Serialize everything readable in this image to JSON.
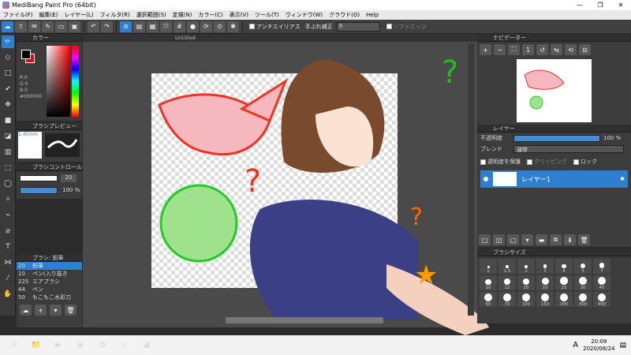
{
  "app": {
    "title": "MediBang Paint Pro (64bit)"
  },
  "menu": [
    "ファイル(F)",
    "編集(E)",
    "レイヤー(L)",
    "フィルタ(R)",
    "選択範囲(S)",
    "定規(N)",
    "カラー(C)",
    "表示(V)",
    "ツール(T)",
    "ウィンドウ(W)",
    "クラウド(O)",
    "Help"
  ],
  "toolbar": {
    "antialias_label": "アンチエイリアス",
    "stabilizer_label": "手ぶれ補正",
    "stabilizer_value": "8",
    "soft_edge_label": "ソフトエッジ"
  },
  "panels": {
    "color": {
      "title": "カラー",
      "r": "R:0",
      "g": "G:0",
      "b": "B:0",
      "hex": "#000000"
    },
    "brush_preview": {
      "title": "ブラシプレビュー",
      "size": "1.45mm"
    },
    "brush_control": {
      "title": "ブラシコントロール",
      "size_value": "20",
      "opacity_value": "100 %"
    },
    "brush_list": {
      "title": "ブラシ: 鉛筆",
      "items": [
        {
          "size": "20",
          "name": "鉛筆",
          "selected": true
        },
        {
          "size": "10",
          "name": "ペン(入り抜き",
          "selected": false
        },
        {
          "size": "225",
          "name": "エアブラシ",
          "selected": false
        },
        {
          "size": "44",
          "name": "ペン",
          "selected": false
        },
        {
          "size": "50",
          "name": "もこもこ水彩刀",
          "selected": false
        }
      ]
    },
    "navigator": {
      "title": "ナビゲーター"
    },
    "layer": {
      "title": "レイヤー",
      "opacity_label": "不透明度",
      "opacity_value": "100 %",
      "blend_label": "ブレンド",
      "blend_value": "通常",
      "protect_label": "透明度を保護",
      "clipping_label": "クリッピング",
      "lock_label": "ロック",
      "layer_name": "レイヤー1"
    },
    "brush_size": {
      "title": "ブラシサイズ",
      "sizes": [
        "1",
        "1.5",
        "2",
        "3",
        "4",
        "5",
        "7",
        "10",
        "12",
        "15",
        "20",
        "25",
        "30",
        "40",
        "50",
        "70",
        "100",
        "150",
        "200",
        "300",
        "400"
      ]
    }
  },
  "canvas": {
    "tab_title": "Untitled"
  },
  "taskbar": {
    "time": "20:09",
    "date": "2020/08/24",
    "ime": "A"
  }
}
